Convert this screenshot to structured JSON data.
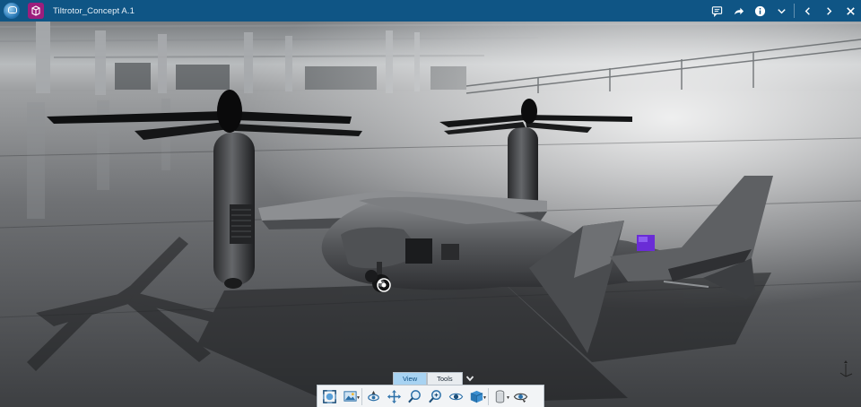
{
  "titlebar": {
    "title": "Tiltrotor_Concept A.1",
    "icons": [
      "compass-app-icon",
      "3d-part-icon",
      "chat-icon",
      "share-icon",
      "info-icon",
      "chevron-down-icon",
      "prev-icon",
      "next-icon",
      "close-icon"
    ]
  },
  "toolbar": {
    "tabs": [
      {
        "label": "View",
        "active": true
      },
      {
        "label": "Tools",
        "active": false
      }
    ],
    "actions": [
      "fit-all-icon",
      "view-mode-icon",
      "fly-mode-icon",
      "pan-icon",
      "zoom-area-icon",
      "zoom-icon",
      "look-at-icon",
      "render-style-icon",
      "cylinder-view-icon",
      "hide-show-icon"
    ]
  },
  "colors": {
    "titlebar_bg": "#0f5585",
    "tab_active": "#a8d3f2",
    "doc_icon": "#9c1e7d",
    "accent_part": "#6a2cd6"
  }
}
